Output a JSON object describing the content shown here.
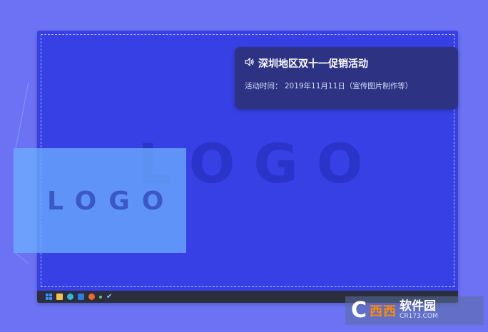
{
  "notification": {
    "icon": "speaker-icon",
    "title": "深圳地区双十一促销活动",
    "subtitle": "活动时间： 2019年11月11日（宣传图片制作等）"
  },
  "canvas": {
    "big_logo": "LOGO",
    "small_logo": "LOGO"
  },
  "taskbar": {
    "icons": [
      "windows-icon",
      "folder-icon",
      "edge-icon",
      "mail-icon",
      "firefox-icon",
      "dot-icon",
      "check-icon"
    ]
  },
  "watermark": {
    "c": "C",
    "xixi": "西西",
    "name": "软件园",
    "url": "CR173.COM"
  }
}
